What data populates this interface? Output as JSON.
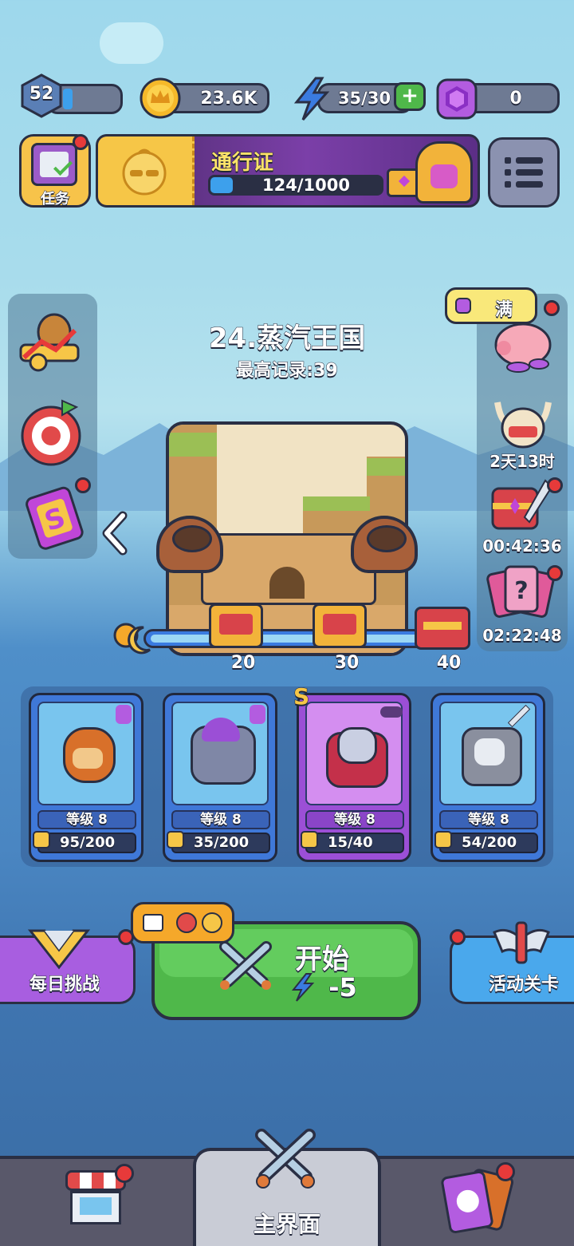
{
  "hud": {
    "level": "52",
    "coins": "23.6K",
    "energy": "35/30",
    "gems": "0"
  },
  "tasks": {
    "label": "任务"
  },
  "pass": {
    "title": "通行证",
    "progress": "124/1000",
    "progress_fraction": 0.124
  },
  "stage": {
    "name": "24.蒸汽王国",
    "record": "最高记录:39"
  },
  "right_side": {
    "piggy_badge": "满",
    "demon_timer": "2天13时",
    "chest_timer": "00:42:36",
    "mystery_timer": "02:22:48"
  },
  "milestones": [
    {
      "label": "20"
    },
    {
      "label": "30"
    },
    {
      "label": "40"
    }
  ],
  "heroes": [
    {
      "level": "等级 8",
      "progress": "95/200",
      "tag": ""
    },
    {
      "level": "等级 8",
      "progress": "35/200",
      "tag": ""
    },
    {
      "level": "等级 8",
      "progress": "15/40",
      "tag": "S"
    },
    {
      "level": "等级 8",
      "progress": "54/200",
      "tag": ""
    }
  ],
  "actions": {
    "daily": "每日挑战",
    "start": "开始",
    "cost": "-5",
    "event": "活动关卡"
  },
  "nav": {
    "main": "主界面"
  },
  "colors": {
    "accent_green": "#4fb84a",
    "accent_purple": "#9b4fd6",
    "accent_blue": "#3f78d8"
  }
}
